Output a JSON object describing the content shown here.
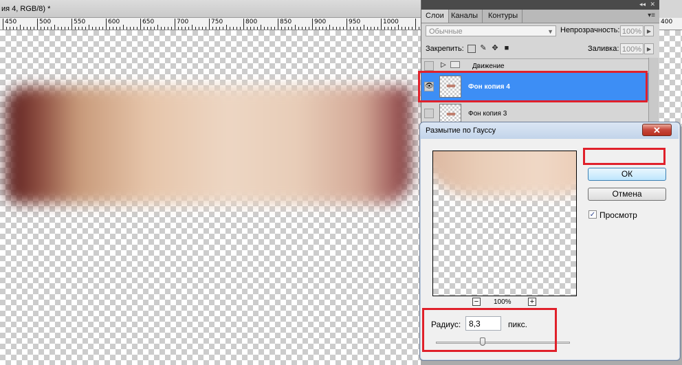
{
  "document": {
    "tab_title": "ия 4, RGB/8) *",
    "close_glyph": "×"
  },
  "ruler": {
    "labels": [
      "450",
      "500",
      "550",
      "600",
      "650",
      "700",
      "750",
      "800",
      "850",
      "900",
      "950",
      "1000",
      "1050"
    ],
    "right_label": "400"
  },
  "layers_panel": {
    "tabs": [
      "Слои",
      "Каналы",
      "Контуры"
    ],
    "active_tab": "Слои",
    "blend_mode": "Обычные",
    "opacity_label": "Непрозрачность:",
    "opacity_value": "100%",
    "lock_label": "Закрепить:",
    "fill_label": "Заливка:",
    "fill_value": "100%",
    "layers": [
      {
        "name": "Движение",
        "type": "group",
        "visible": false
      },
      {
        "name": "Фон копия 4",
        "type": "layer",
        "visible": true,
        "selected": true
      },
      {
        "name": "Фон копия 3",
        "type": "layer",
        "visible": false
      }
    ]
  },
  "gauss_dialog": {
    "title": "Размытие по Гауссу",
    "ok_label": "ОК",
    "cancel_label": "Отмена",
    "preview_label": "Просмотр",
    "preview_checked": true,
    "zoom_minus": "−",
    "zoom_plus": "+",
    "zoom_level": "100%",
    "radius_label": "Радиус:",
    "radius_value": "8,3",
    "radius_unit": "пикс.",
    "radius_slider_fraction": 0.35
  },
  "colors": {
    "selected_layer": "#3d8ef5",
    "highlight": "#e0202a"
  },
  "icons": [
    "eye-icon",
    "folder-icon",
    "disclosure-triangle-icon",
    "lock-transparent-icon",
    "lock-brush-icon",
    "lock-move-icon",
    "lock-all-icon",
    "close-icon"
  ]
}
